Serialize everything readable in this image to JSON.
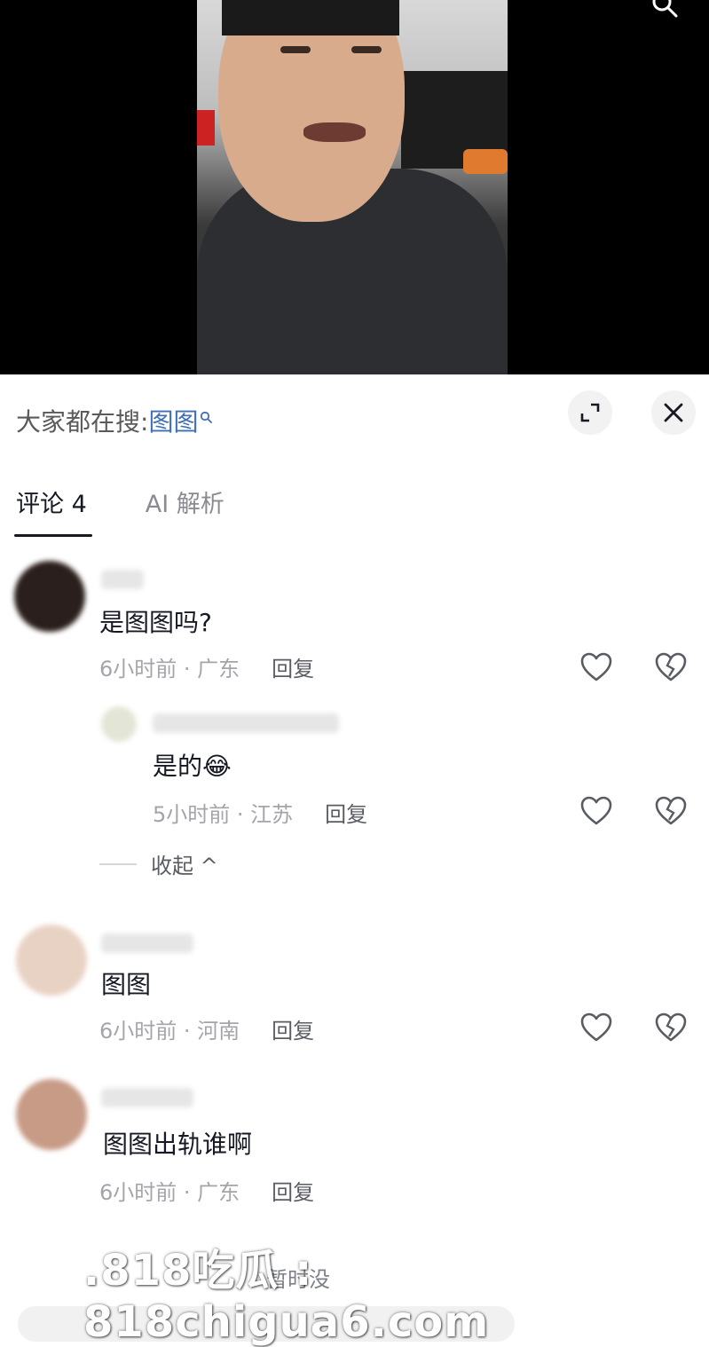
{
  "header": {
    "hot_search_prefix": "大家都在搜:",
    "hot_search_term": "图图"
  },
  "tabs": [
    {
      "label": "评论 4",
      "active": true
    },
    {
      "label": "AI 解析",
      "active": false
    }
  ],
  "comments": [
    {
      "text": "是图图吗?",
      "time": "6小时前 · 广东",
      "reply_label": "回复",
      "avatar_color": "#2a1f1c",
      "replies": [
        {
          "text": "是的😂",
          "time": "5小时前 · 江苏",
          "reply_label": "回复"
        }
      ],
      "collapse_label": "收起 ^"
    },
    {
      "text": "图图",
      "time": "6小时前 · 河南",
      "reply_label": "回复",
      "avatar_color": "#e8d2c4"
    },
    {
      "text": "图图出轨谁啊",
      "time": "6小时前 · 广东",
      "reply_label": "回复",
      "avatar_color": "#c79b86"
    }
  ],
  "watermark": ".818吃瓜 : 818chigua6.com",
  "sort_hint": "暂时没",
  "colors": {
    "link": "#3f6fb6",
    "primary_text": "#161823",
    "secondary_text": "#a3a5ab"
  },
  "icons": [
    "search-icon",
    "expand-icon",
    "close-icon",
    "heart-icon",
    "broken-heart-icon",
    "chevron-up-icon"
  ]
}
